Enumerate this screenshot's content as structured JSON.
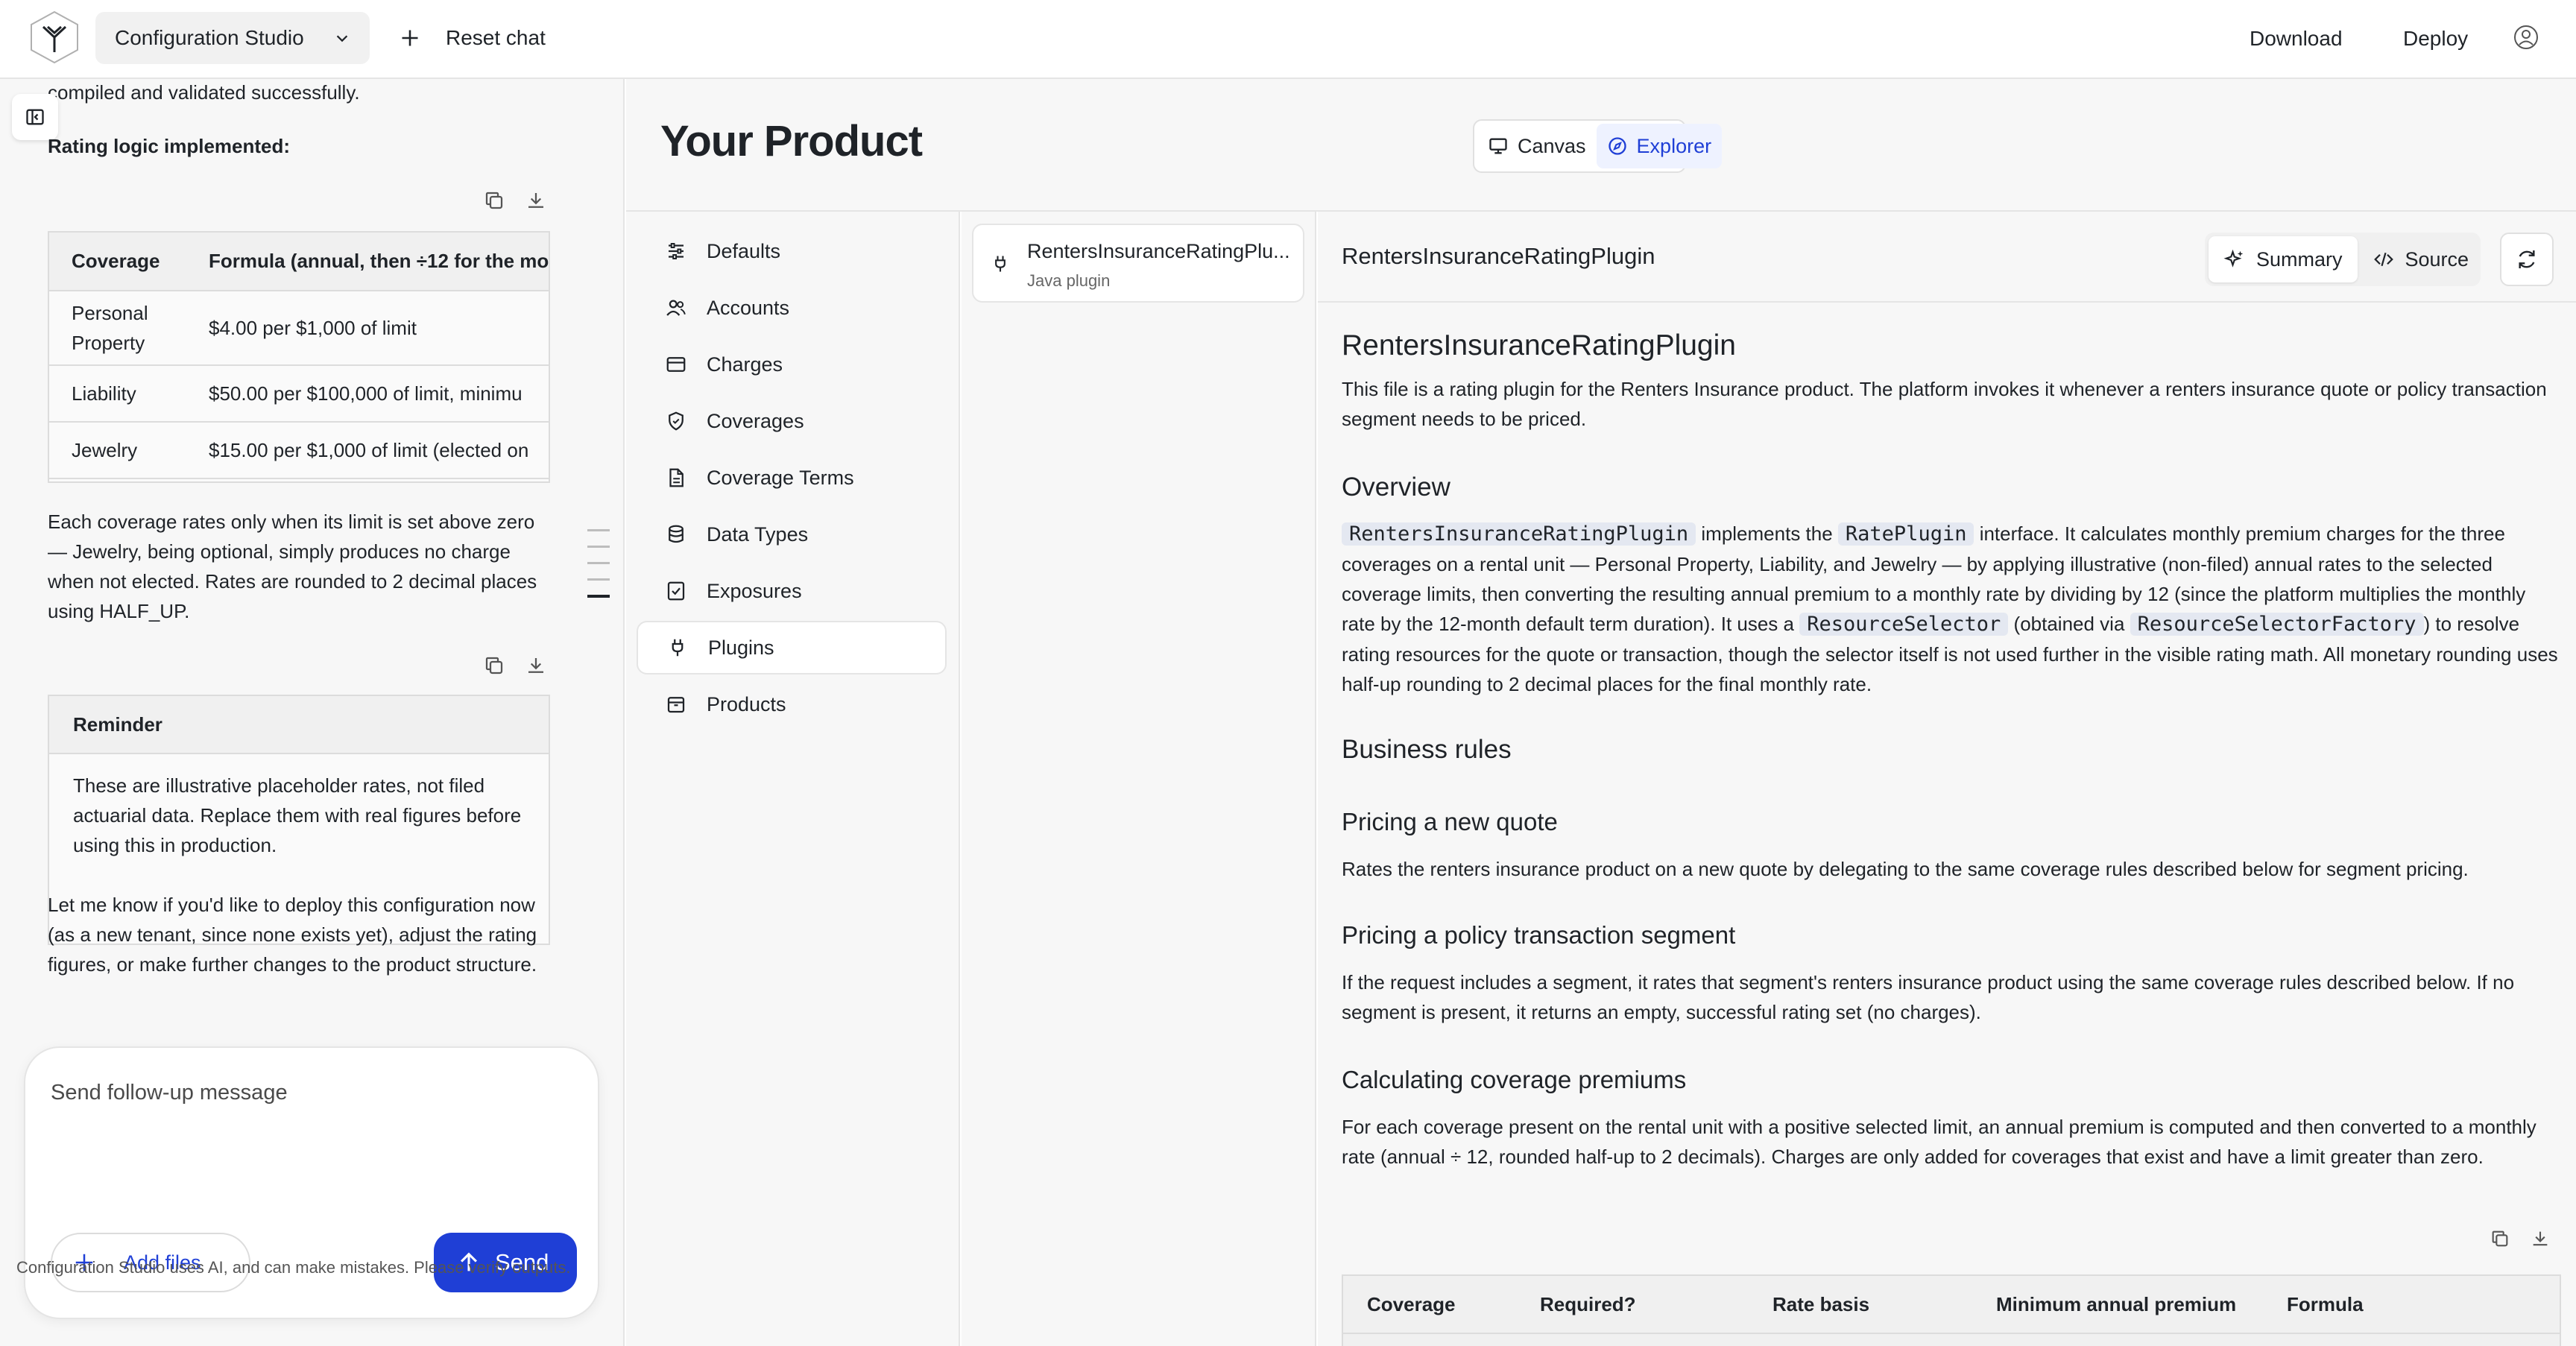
{
  "topbar": {
    "app_name": "Configuration Studio",
    "reset_label": "Reset chat",
    "download_label": "Download",
    "deploy_label": "Deploy"
  },
  "chat": {
    "line_top": "compiled and validated successfully.",
    "rating_heading": "Rating logic implemented:",
    "rating_table": {
      "headers": [
        "Coverage",
        "Formula (annual, then ÷12 for the mo"
      ],
      "rows": [
        [
          "Personal Property",
          "$4.00 per $1,000 of limit"
        ],
        [
          "Liability",
          "$50.00 per $100,000 of limit, minimu"
        ],
        [
          "Jewelry",
          "$15.00 per $1,000 of limit (elected on"
        ]
      ]
    },
    "para1": "Each coverage rates only when its limit is set above zero — Jewelry, being optional, simply produces no charge when not elected. Rates are rounded to 2 decimal places using HALF_UP.",
    "reminder": {
      "title": "Reminder",
      "body": "These are illustrative placeholder rates, not filed actuarial data. Replace them with real figures before using this in production."
    },
    "para2": "Let me know if you'd like to deploy this configuration now (as a new tenant, since none exists yet), adjust the rating figures, or make further changes to the product structure.",
    "composer": {
      "placeholder": "Send follow-up message",
      "add_files_label": "Add files",
      "send_label": "Send"
    },
    "disclaimer": "Configuration Studio uses AI, and can make mistakes. Please verify outputs."
  },
  "main": {
    "title": "Your Product",
    "views": [
      "Canvas",
      "Explorer"
    ],
    "active_view": "Explorer"
  },
  "nav": {
    "items": [
      {
        "label": "Defaults",
        "icon": "sliders-icon"
      },
      {
        "label": "Accounts",
        "icon": "users-icon"
      },
      {
        "label": "Charges",
        "icon": "card-icon"
      },
      {
        "label": "Coverages",
        "icon": "shield-icon"
      },
      {
        "label": "Coverage Terms",
        "icon": "document-icon"
      },
      {
        "label": "Data Types",
        "icon": "database-icon"
      },
      {
        "label": "Exposures",
        "icon": "checklist-icon"
      },
      {
        "label": "Plugins",
        "icon": "plug-icon"
      },
      {
        "label": "Products",
        "icon": "box-icon"
      }
    ],
    "active": "Plugins"
  },
  "files": {
    "items": [
      {
        "name": "RentersInsuranceRatingPlu...",
        "type": "Java plugin"
      }
    ]
  },
  "doc": {
    "header_title": "RentersInsuranceRatingPlugin",
    "tabs": [
      "Summary",
      "Source"
    ],
    "active_tab": "Summary",
    "h1": "RentersInsuranceRatingPlugin",
    "intro": "This file is a rating plugin for the Renters Insurance product. The platform invokes it whenever a renters insurance quote or policy transaction segment needs to be priced.",
    "overview_heading": "Overview",
    "overview": {
      "code1": "RentersInsuranceRatingPlugin",
      "text1": " implements the ",
      "code2": "RatePlugin",
      "text2": " interface. It calculates monthly premium charges for the three coverages on a rental unit — Personal Property, Liability, and Jewelry — by applying illustrative (non-filed) annual rates to the selected coverage limits, then converting the resulting annual premium to a monthly rate by dividing by 12 (since the platform multiplies the monthly rate by the 12-month default term duration). It uses a ",
      "code3": "ResourceSelector",
      "text3": " (obtained via ",
      "code4": "ResourceSelectorFactory",
      "text4": ") to resolve rating resources for the quote or transaction, though the selector itself is not used further in the visible rating math. All monetary rounding uses half-up rounding to 2 decimal places for the final monthly rate."
    },
    "business_rules_heading": "Business rules",
    "quote_heading": "Pricing a new quote",
    "quote_text": "Rates the renters insurance product on a new quote by delegating to the same coverage rules described below for segment pricing.",
    "segment_heading": "Pricing a policy transaction segment",
    "segment_text": "If the request includes a segment, it rates that segment's renters insurance product using the same coverage rules described below. If no segment is present, it returns an empty, successful rating set (no charges).",
    "calc_heading": "Calculating coverage premiums",
    "calc_text": "For each coverage present on the rental unit with a positive selected limit, an annual premium is computed and then converted to a monthly rate (annual ÷ 12, rounded half-up to 2 decimals). Charges are only added for coverages that exist and have a limit greater than zero.",
    "table_headers": [
      "Coverage",
      "Required?",
      "Rate basis",
      "Minimum annual premium",
      "Formula"
    ]
  },
  "colors": {
    "accent": "#1f3fd6",
    "panel_bg": "#f7f7f7",
    "code_chip": "#e4e8f1"
  }
}
